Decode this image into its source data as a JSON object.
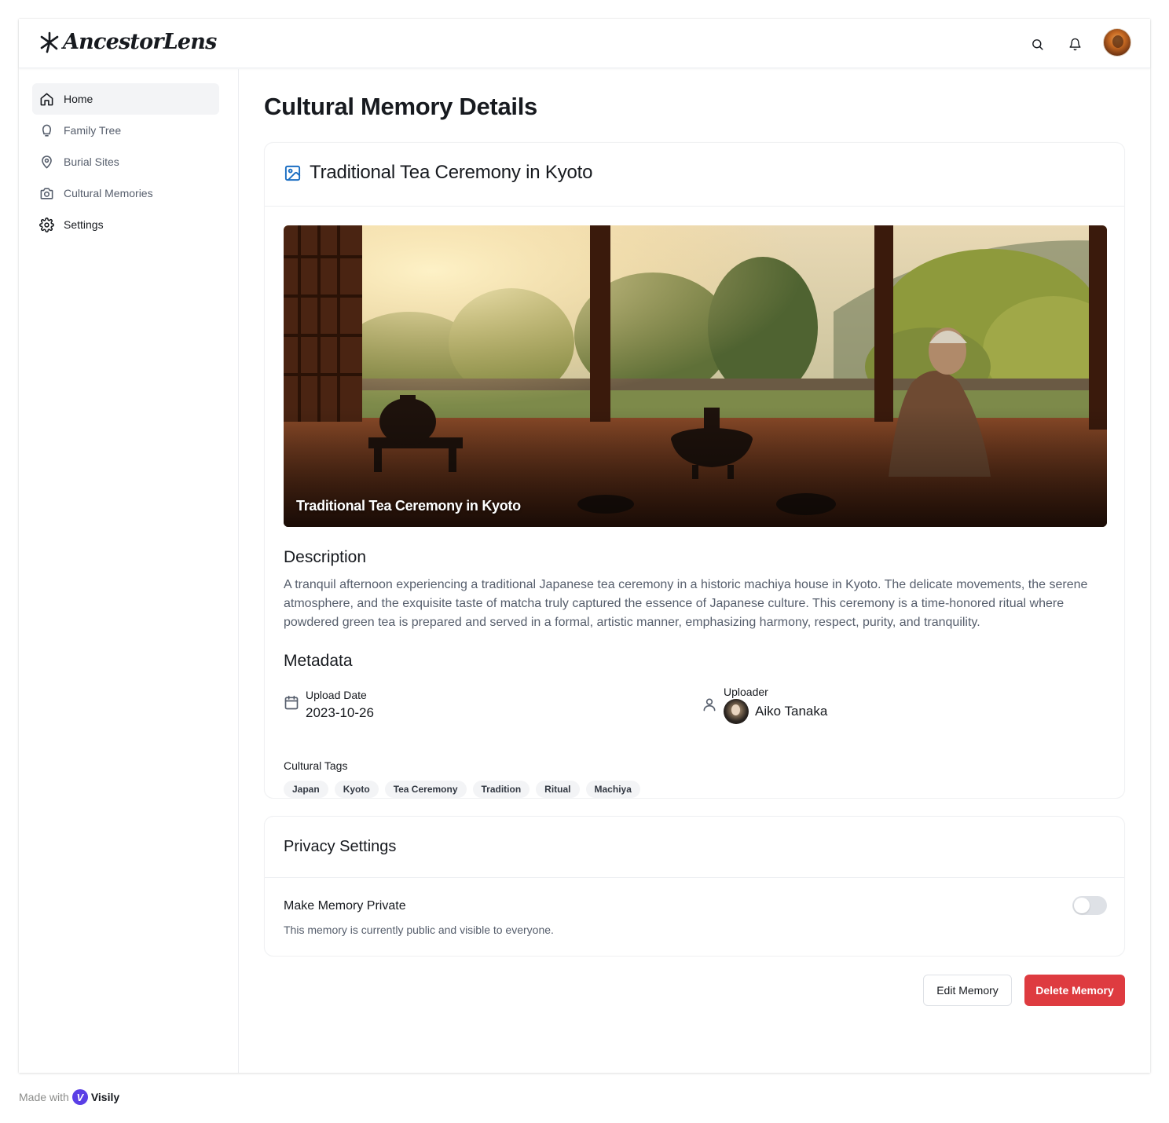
{
  "app": {
    "brand_name": "AncestorLens"
  },
  "header": {
    "search_icon": "search-icon",
    "bell_icon": "bell-icon"
  },
  "sidebar": {
    "items": [
      {
        "label": "Home",
        "icon": "home-icon",
        "active": true
      },
      {
        "label": "Family Tree",
        "icon": "tree-icon",
        "active": false
      },
      {
        "label": "Burial Sites",
        "icon": "map-pin-icon",
        "active": false
      },
      {
        "label": "Cultural Memories",
        "icon": "camera-icon",
        "active": false
      },
      {
        "label": "Settings",
        "icon": "gear-icon",
        "active": false
      }
    ]
  },
  "page": {
    "title": "Cultural Memory Details"
  },
  "memory": {
    "title": "Traditional Tea Ceremony in Kyoto",
    "photo_caption": "Traditional Tea Ceremony in Kyoto",
    "description_heading": "Description",
    "description": "A tranquil afternoon experiencing a traditional Japanese tea ceremony in a historic machiya house in Kyoto. The delicate movements, the serene atmosphere, and the exquisite taste of matcha truly captured the essence of Japanese culture. This ceremony is a time-honored ritual where powdered green tea is prepared and served in a formal, artistic manner, emphasizing harmony, respect, purity, and tranquility.",
    "metadata_heading": "Metadata",
    "upload_date_label": "Upload Date",
    "upload_date": "2023-10-26",
    "uploader_label": "Uploader",
    "uploader_name": "Aiko Tanaka",
    "tags_label": "Cultural Tags",
    "tags": [
      "Japan",
      "Kyoto",
      "Tea Ceremony",
      "Tradition",
      "Ritual",
      "Machiya"
    ]
  },
  "privacy": {
    "heading": "Privacy Settings",
    "toggle_label": "Make Memory Private",
    "toggle_on": false,
    "status_text": "This memory is currently public and visible to everyone."
  },
  "actions": {
    "edit_label": "Edit Memory",
    "delete_label": "Delete Memory"
  },
  "footer": {
    "made_with": "Made with",
    "brand": "Visily"
  },
  "colors": {
    "accent": "#1b6ec2",
    "danger": "#de3b40",
    "active_bg": "#f3f4f6"
  }
}
